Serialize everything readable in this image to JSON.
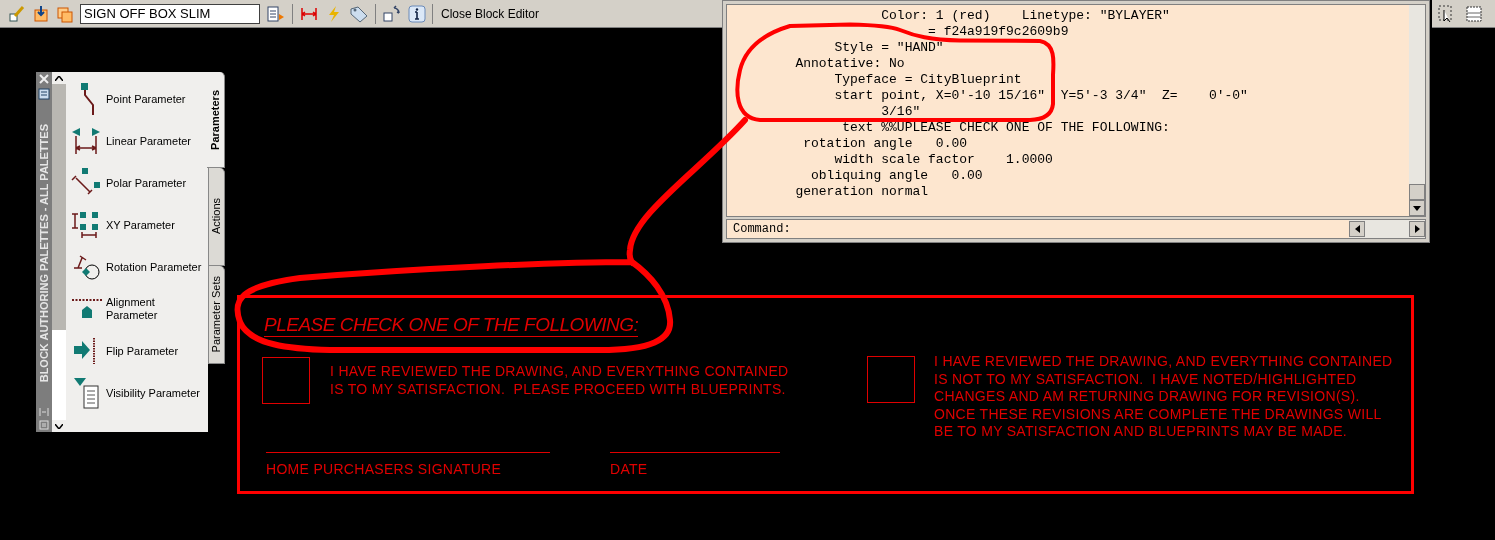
{
  "toolbar": {
    "block_name": "SIGN OFF BOX SLIM",
    "close_label": "Close Block Editor"
  },
  "command_window": {
    "lines": [
      "                   Color: 1 (red)    Linetype: \"BYLAYER\"",
      "                         = f24a919f9c2609b9",
      "             Style = \"HAND\"",
      "        Annotative: No",
      "             Typeface = CityBlueprint",
      "             start point, X=0'-10 15/16\"  Y=5'-3 3/4\"  Z=    0'-0\"",
      "                   3/16\"",
      "              text %%UPLEASE CHECK ONE OF THE FOLLOWING:",
      "         rotation angle   0.00",
      "             width scale factor    1.0000",
      "          obliquing angle   0.00",
      "        generation normal"
    ],
    "prompt": "Command:"
  },
  "palette": {
    "title": "BLOCK AUTHORING PALETTES - ALL PALETTES",
    "items": [
      {
        "kind": "point",
        "label": "Point Parameter"
      },
      {
        "kind": "linear",
        "label": "Linear Parameter"
      },
      {
        "kind": "polar",
        "label": "Polar Parameter"
      },
      {
        "kind": "xy",
        "label": "XY Parameter"
      },
      {
        "kind": "rotation",
        "label": "Rotation Parameter"
      },
      {
        "kind": "alignment",
        "label": "Alignment Parameter"
      },
      {
        "kind": "flip",
        "label": "Flip Parameter"
      },
      {
        "kind": "visibility",
        "label": "Visibility Parameter"
      }
    ],
    "tabs": [
      {
        "label": "Parameters",
        "selected": true
      },
      {
        "label": "Actions",
        "selected": false
      },
      {
        "label": "Parameter Sets",
        "selected": false
      }
    ]
  },
  "drawing": {
    "heading": "PLEASE CHECK ONE OF THE FOLLOWING:",
    "options": [
      {
        "checked": false,
        "text": "I HAVE REVIEWED THE DRAWING, AND EVERYTHING CONTAINED\nIS TO MY SATISFACTION.  PLEASE PROCEED WITH BLUEPRINTS."
      },
      {
        "checked": false,
        "text": "I HAVE REVIEWED THE DRAWING, AND EVERYTHING CONTAINED\nIS NOT TO MY SATISFACTION.  I HAVE NOTED/HIGHLIGHTED\nCHANGES AND AM RETURNING DRAWING FOR REVISION(S).\nONCE THESE REVISIONS ARE COMPLETE THE DRAWINGS WILL\nBE TO MY SATISFACTION AND BLUEPRINTS MAY BE MADE."
      }
    ],
    "signature_fields": [
      {
        "label": "HOME PURCHASERS SIGNATURE"
      },
      {
        "label": "DATE"
      }
    ]
  }
}
